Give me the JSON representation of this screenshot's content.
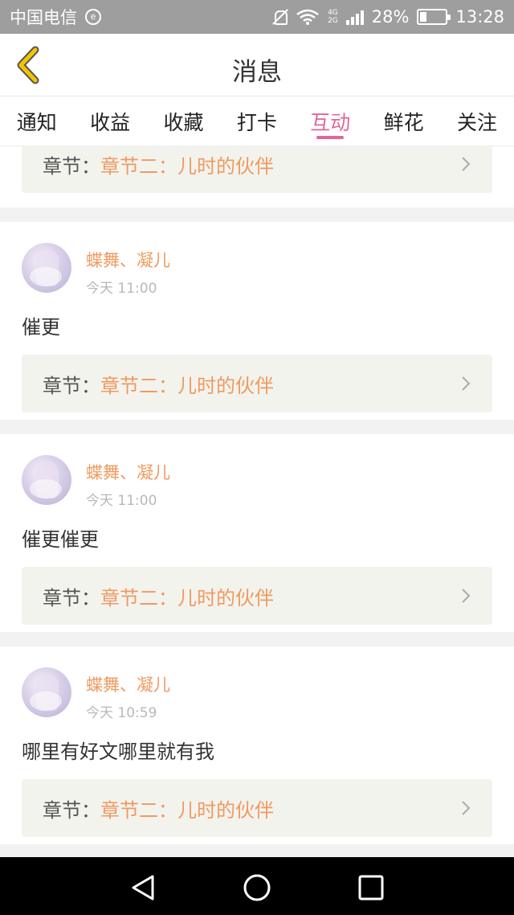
{
  "status_bar": {
    "carrier": "中国电信",
    "signal_badge": "e",
    "network_top": "4G",
    "network_bottom": "2G",
    "battery": "28%",
    "time": "13:28"
  },
  "header": {
    "title": "消息"
  },
  "tabs": [
    {
      "label": "通知",
      "active": false
    },
    {
      "label": "收益",
      "active": false
    },
    {
      "label": "收藏",
      "active": false
    },
    {
      "label": "打卡",
      "active": false
    },
    {
      "label": "互动",
      "active": true
    },
    {
      "label": "鲜花",
      "active": false
    },
    {
      "label": "关注",
      "active": false
    }
  ],
  "messages": [
    {
      "chapter_label": "章节：",
      "chapter_name": "章节二：儿时的伙伴"
    },
    {
      "username": "蝶舞、凝儿",
      "time": "今天 11:00",
      "text": "催更",
      "chapter_label": "章节：",
      "chapter_name": "章节二：儿时的伙伴"
    },
    {
      "username": "蝶舞、凝儿",
      "time": "今天 11:00",
      "text": "催更催更",
      "chapter_label": "章节：",
      "chapter_name": "章节二：儿时的伙伴"
    },
    {
      "username": "蝶舞、凝儿",
      "time": "今天 10:59",
      "text": "哪里有好文哪里就有我",
      "chapter_label": "章节：",
      "chapter_name": "章节二：儿时的伙伴"
    }
  ],
  "colors": {
    "accent_pink": "#e2669b",
    "name_orange": "#f09a60",
    "back_yellow": "#f5c400"
  }
}
